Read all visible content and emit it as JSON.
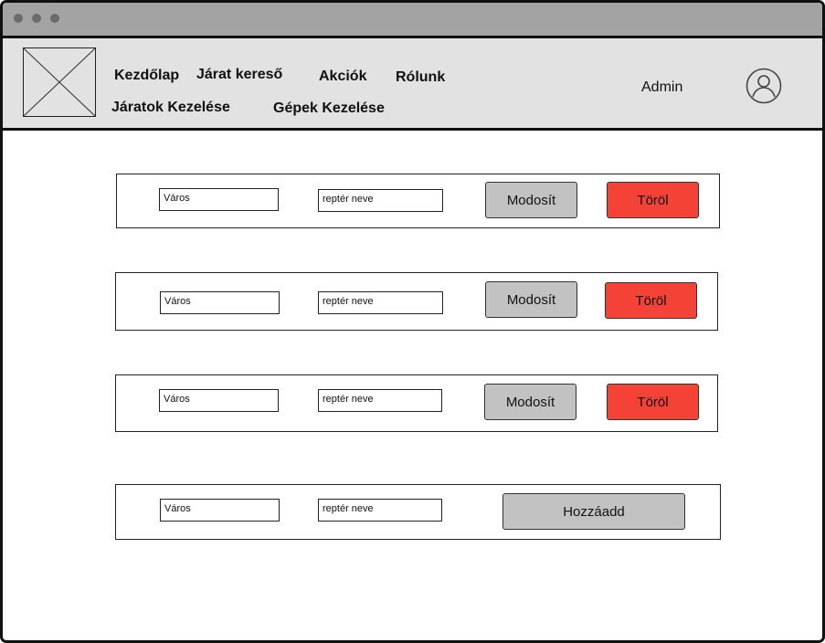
{
  "window": {
    "controls": [
      "dot-icon",
      "dot-icon",
      "dot-icon"
    ]
  },
  "header": {
    "logo_icon": "image-placeholder-icon",
    "nav": {
      "home": "Kezdőlap",
      "flight_search": "Járat kereső",
      "deals": "Akciók",
      "about": "Rólunk",
      "manage_flights": "Járatok Kezelése",
      "manage_planes": "Gépek Kezelése"
    },
    "user_label": "Admin",
    "user_icon": "user-avatar-icon"
  },
  "rows": [
    {
      "city_placeholder": "Város",
      "airport_placeholder": "reptér neve",
      "edit_label": "Modosít",
      "delete_label": "Töröl"
    },
    {
      "city_placeholder": "Város",
      "airport_placeholder": "reptér neve",
      "edit_label": "Modosít",
      "delete_label": "Töröl"
    },
    {
      "city_placeholder": "Város",
      "airport_placeholder": "reptér neve",
      "edit_label": "Modosít",
      "delete_label": "Töröl"
    }
  ],
  "add_row": {
    "city_placeholder": "Város",
    "airport_placeholder": "reptér neve",
    "add_label": "Hozzáadd"
  },
  "colors": {
    "titlebar": "#a3a3a3",
    "header": "#e2e2e2",
    "button_gray": "#c2c2c2",
    "button_delete": "#f44336"
  }
}
